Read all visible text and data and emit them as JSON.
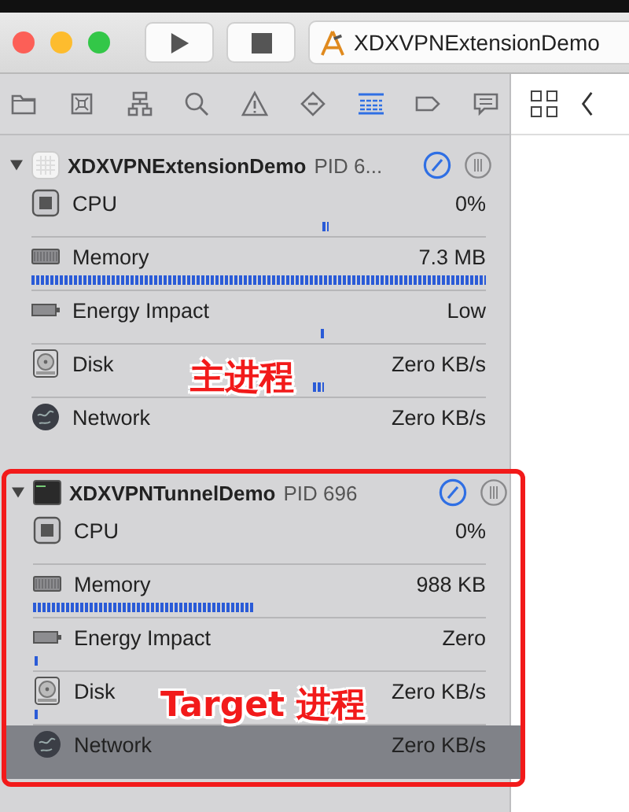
{
  "toolbar": {
    "scheme": "XDXVPNExtensionDemo"
  },
  "navigator_tabs": [
    {
      "kind": "folder",
      "selected": false
    },
    {
      "kind": "source",
      "selected": false
    },
    {
      "kind": "hierarchy",
      "selected": false
    },
    {
      "kind": "search",
      "selected": false
    },
    {
      "kind": "warning",
      "selected": false
    },
    {
      "kind": "test",
      "selected": false
    },
    {
      "kind": "debug",
      "selected": true
    },
    {
      "kind": "breakpoint",
      "selected": false
    },
    {
      "kind": "report",
      "selected": false
    }
  ],
  "processes": [
    {
      "kind": "app",
      "name": "XDXVPNExtensionDemo",
      "pid": "PID 6...",
      "expanded": true,
      "highlighted": false,
      "annotation": "主进程",
      "metrics": [
        {
          "kind": "cpu",
          "label": "CPU",
          "value": "0%",
          "selected": false
        },
        {
          "kind": "memory",
          "label": "Memory",
          "value": "7.3 MB",
          "selected": false
        },
        {
          "kind": "energy",
          "label": "Energy Impact",
          "value": "Low",
          "selected": false
        },
        {
          "kind": "disk",
          "label": "Disk",
          "value": "Zero KB/s",
          "selected": false
        },
        {
          "kind": "network",
          "label": "Network",
          "value": "Zero KB/s",
          "selected": false
        }
      ]
    },
    {
      "kind": "terminal",
      "name": "XDXVPNTunnelDemo",
      "pid": "PID 696",
      "expanded": true,
      "highlighted": true,
      "annotation": "Target 进程",
      "metrics": [
        {
          "kind": "cpu",
          "label": "CPU",
          "value": "0%",
          "selected": false
        },
        {
          "kind": "memory",
          "label": "Memory",
          "value": "988 KB",
          "selected": false
        },
        {
          "kind": "energy",
          "label": "Energy Impact",
          "value": "Zero",
          "selected": false
        },
        {
          "kind": "disk",
          "label": "Disk",
          "value": "Zero KB/s",
          "selected": false
        },
        {
          "kind": "network",
          "label": "Network",
          "value": "Zero KB/s",
          "selected": true
        }
      ]
    }
  ]
}
